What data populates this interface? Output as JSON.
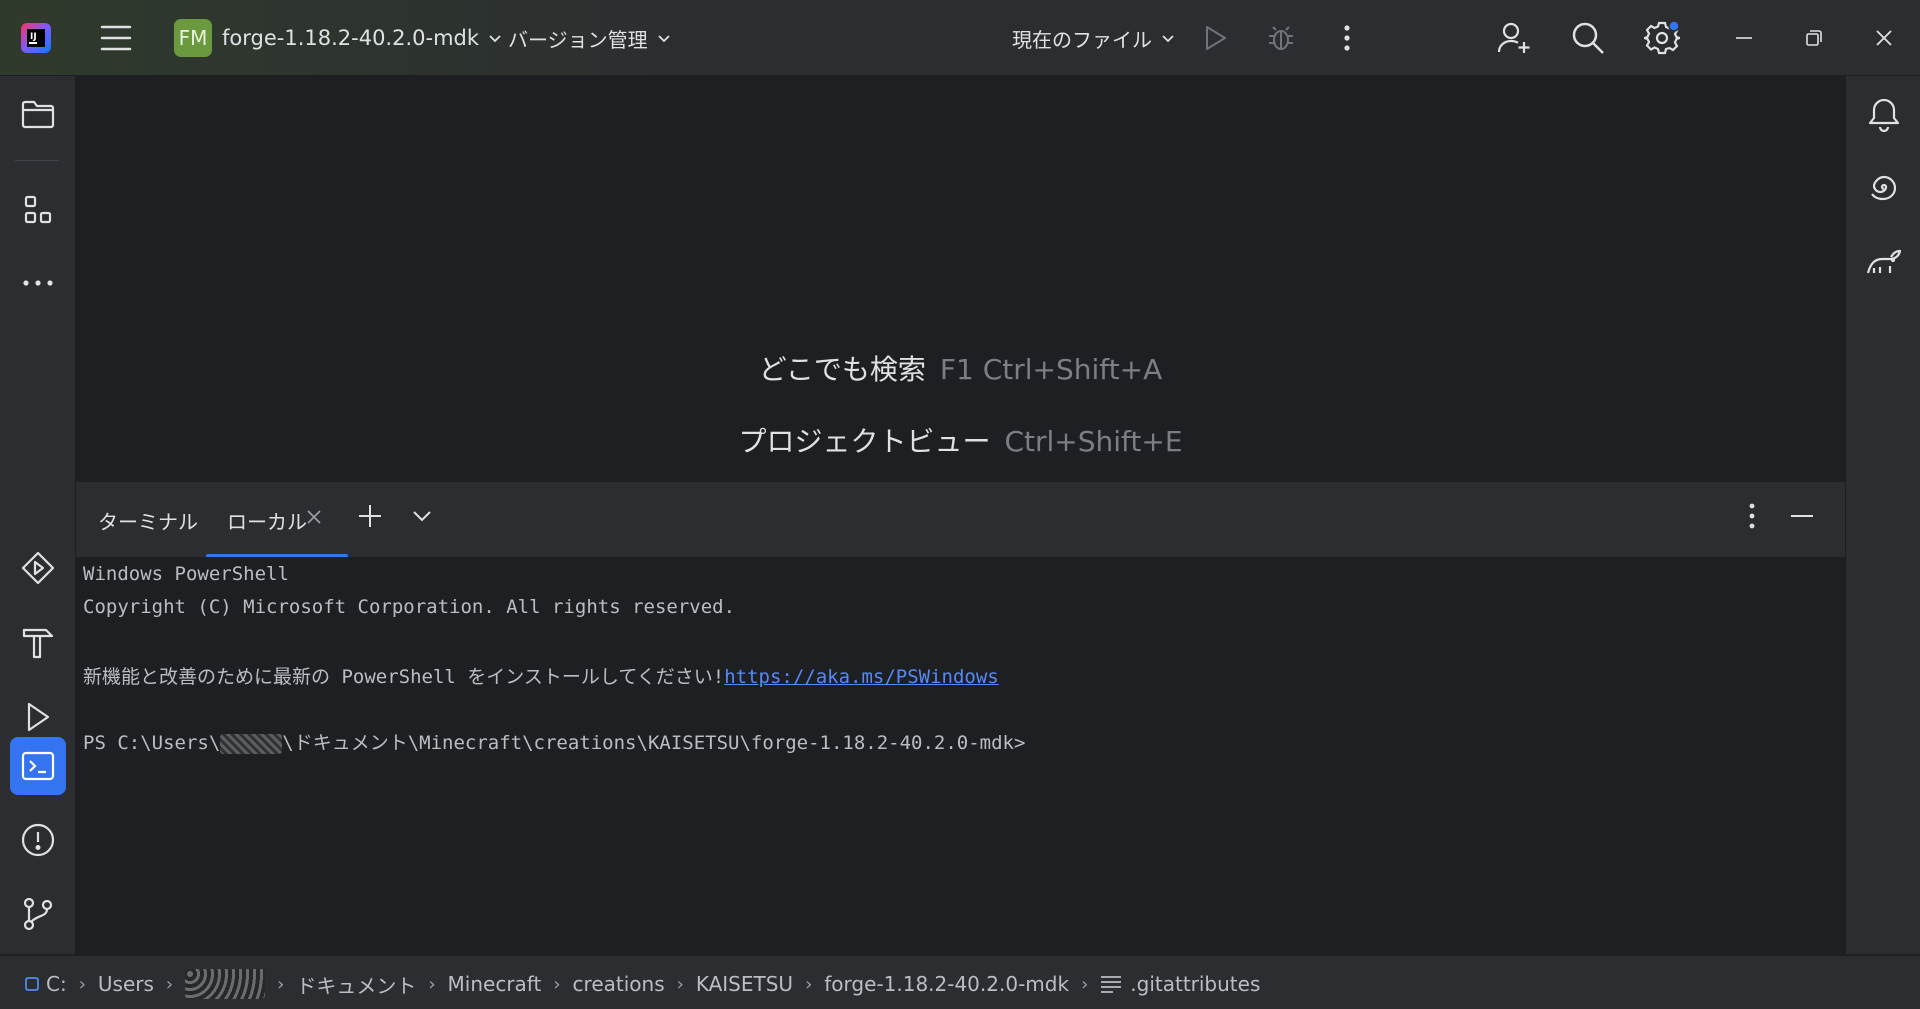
{
  "titlebar": {
    "project_badge": "FM",
    "project_name": "forge-1.18.2-40.2.0-mdk",
    "vcs_label": "バージョン管理",
    "run_config_label": "現在のファイル"
  },
  "editor": {
    "hints": [
      {
        "label": "どこでも検索",
        "shortcut": "F1 Ctrl+Shift+A"
      },
      {
        "label": "プロジェクトビュー",
        "shortcut": "Ctrl+Shift+E"
      }
    ]
  },
  "terminal": {
    "title": "ターミナル",
    "tab_label": "ローカル",
    "lines": {
      "l1": "Windows PowerShell",
      "l2": "Copyright (C) Microsoft Corporation. All rights reserved.",
      "l3_text": "新機能と改善のために最新の PowerShell をインストールしてください!",
      "l3_link": "https://aka.ms/PSWindows",
      "prompt_prefix": "PS C:\\Users\\",
      "prompt_suffix": "\\ドキュメント\\Minecraft\\creations\\KAISETSU\\forge-1.18.2-40.2.0-mdk>"
    }
  },
  "breadcrumbs": {
    "drive": "C:",
    "users": "Users",
    "documents": "ドキュメント",
    "minecraft": "Minecraft",
    "creations": "creations",
    "kaisetsu": "KAISETSU",
    "project": "forge-1.18.2-40.2.0-mdk",
    "file": ".gitattributes"
  },
  "colors": {
    "accent": "#3574f0",
    "project_badge": "#6b9a3e",
    "link": "#548af7",
    "notification_dot": "#3574f0"
  }
}
